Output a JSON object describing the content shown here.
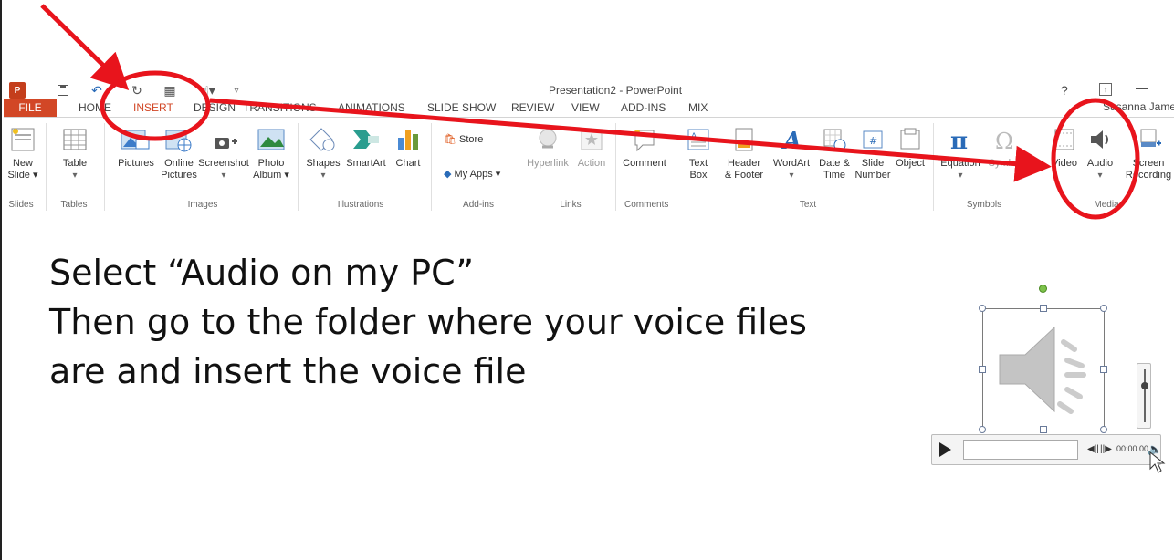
{
  "window": {
    "title": "Presentation2 - PowerPoint",
    "help": "?",
    "restore": "↑",
    "minimize": "—",
    "app_logo": "P"
  },
  "qat": {
    "save_icon": "floppy-icon",
    "undo_icon": "undo-icon",
    "touch_icon": "touch-icon"
  },
  "tabs": [
    {
      "label": "FILE"
    },
    {
      "label": "HOME"
    },
    {
      "label": "INSERT"
    },
    {
      "label": "DESIGN"
    },
    {
      "label": "TRANSITIONS"
    },
    {
      "label": "ANIMATIONS"
    },
    {
      "label": "SLIDE SHOW"
    },
    {
      "label": "REVIEW"
    },
    {
      "label": "VIEW"
    },
    {
      "label": "ADD-INS"
    },
    {
      "label": "MIX"
    }
  ],
  "user": "Susanna Jame",
  "ribbon": {
    "new_slide": {
      "l1": "New",
      "l2": "Slide ▾"
    },
    "table": {
      "l1": "Table",
      "l2": "▾"
    },
    "pictures": "Pictures",
    "online_pictures": {
      "l1": "Online",
      "l2": "Pictures"
    },
    "screenshot": {
      "l1": "Screenshot",
      "l2": "▾"
    },
    "photo_album": {
      "l1": "Photo",
      "l2": "Album ▾"
    },
    "shapes": {
      "l1": "Shapes",
      "l2": "▾"
    },
    "smartart": "SmartArt",
    "chart": "Chart",
    "store": "Store",
    "my_apps": "My Apps ▾",
    "hyperlink": "Hyperlink",
    "action": "Action",
    "comment": "Comment",
    "text_box": {
      "l1": "Text",
      "l2": "Box"
    },
    "header_footer": {
      "l1": "Header",
      "l2": "& Footer"
    },
    "wordart": {
      "l1": "WordArt",
      "l2": "▾"
    },
    "date_time": {
      "l1": "Date &",
      "l2": "Time"
    },
    "slide_number": {
      "l1": "Slide",
      "l2": "Number"
    },
    "object": "Object",
    "equation": {
      "l1": "Equation",
      "l2": "▾"
    },
    "symbol": "Symbol",
    "video": "Video",
    "audio": {
      "l1": "Audio",
      "l2": "▾"
    },
    "screen_recording": {
      "l1": "Screen",
      "l2": "Recording"
    },
    "groups": {
      "slides": "Slides",
      "tables": "Tables",
      "images": "Images",
      "illustrations": "Illustrations",
      "addins": "Add-ins",
      "links": "Links",
      "comments": "Comments",
      "text": "Text",
      "symbols": "Symbols",
      "media": "Media"
    }
  },
  "slide": {
    "line1": "Select “Audio on my PC”",
    "line2": "Then go to the folder where your voice files",
    "line3": "are and insert the voice file"
  },
  "player": {
    "time": "00:00.00",
    "skip_back": "◀||",
    "skip_fwd": "||▶"
  },
  "colors": {
    "accent": "#d24726",
    "annotation": "#e8141c"
  }
}
